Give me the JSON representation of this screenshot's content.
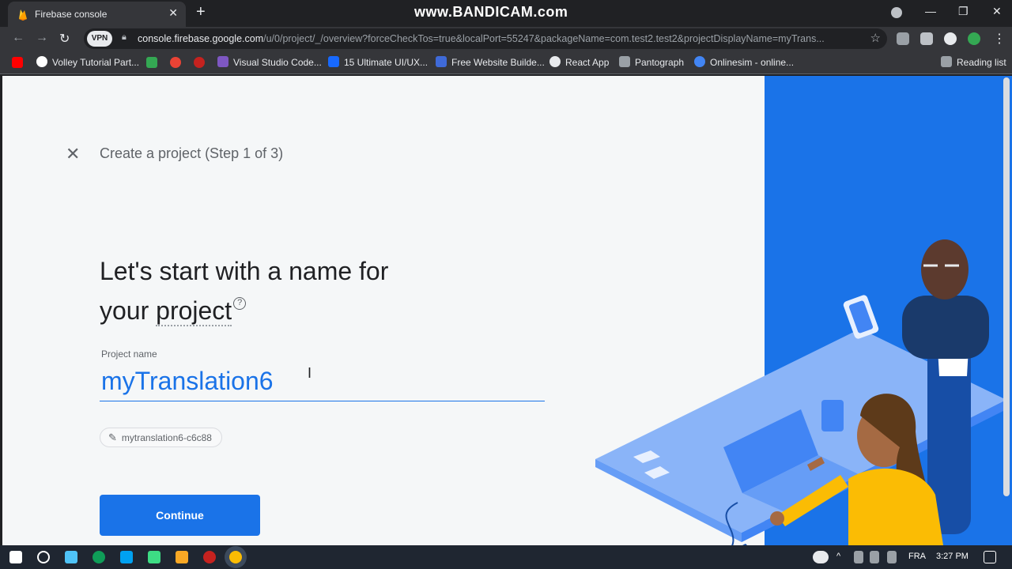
{
  "browser": {
    "tab_title": "Firebase console",
    "tab_close": "✕",
    "new_tab": "+",
    "watermark": "www.BANDICAM.com",
    "window_controls": {
      "minimize": "—",
      "restore": "❐",
      "close": "✕"
    },
    "vpn": "VPN",
    "url_host": "console.firebase.google.com",
    "url_path": "/u/0/project/_/overview?forceCheckTos=true&localPort=55247&packageName=com.test2.test2&projectDisplayName=myTrans...",
    "bookmarks": [
      {
        "label": "Volley Tutorial Part...",
        "icon_color": "#ffffff"
      },
      {
        "label": "Visual Studio Code...",
        "icon_color": "#7e57c2"
      },
      {
        "label": "15 Ultimate UI/UX...",
        "icon_color": "#1769ff"
      },
      {
        "label": "Free Website Builde...",
        "icon_color": "#3f6ad8"
      },
      {
        "label": "React App",
        "icon_color": "#e8eaed"
      },
      {
        "label": "Pantograph",
        "icon_color": "#9aa0a6"
      },
      {
        "label": "Onlinesim - online...",
        "icon_color": "#4285f4"
      }
    ],
    "reading_list": "Reading list"
  },
  "page": {
    "close_label": "✕",
    "step_title": "Create a project (Step 1 of 3)",
    "headline_line1": "Let's start with a name for",
    "headline_line2_prefix": "your ",
    "headline_line2_term": "project",
    "help_glyph": "?",
    "field_label": "Project name",
    "project_name_value": "myTranslation6",
    "project_id": "mytranslation6-c6c88",
    "continue_label": "Continue"
  },
  "taskbar": {
    "language": "FRA",
    "time": "3:27 PM"
  },
  "colors": {
    "accent": "#1a73e8",
    "hero_blue": "#1a73e8",
    "person_yellow": "#fbbc04"
  }
}
